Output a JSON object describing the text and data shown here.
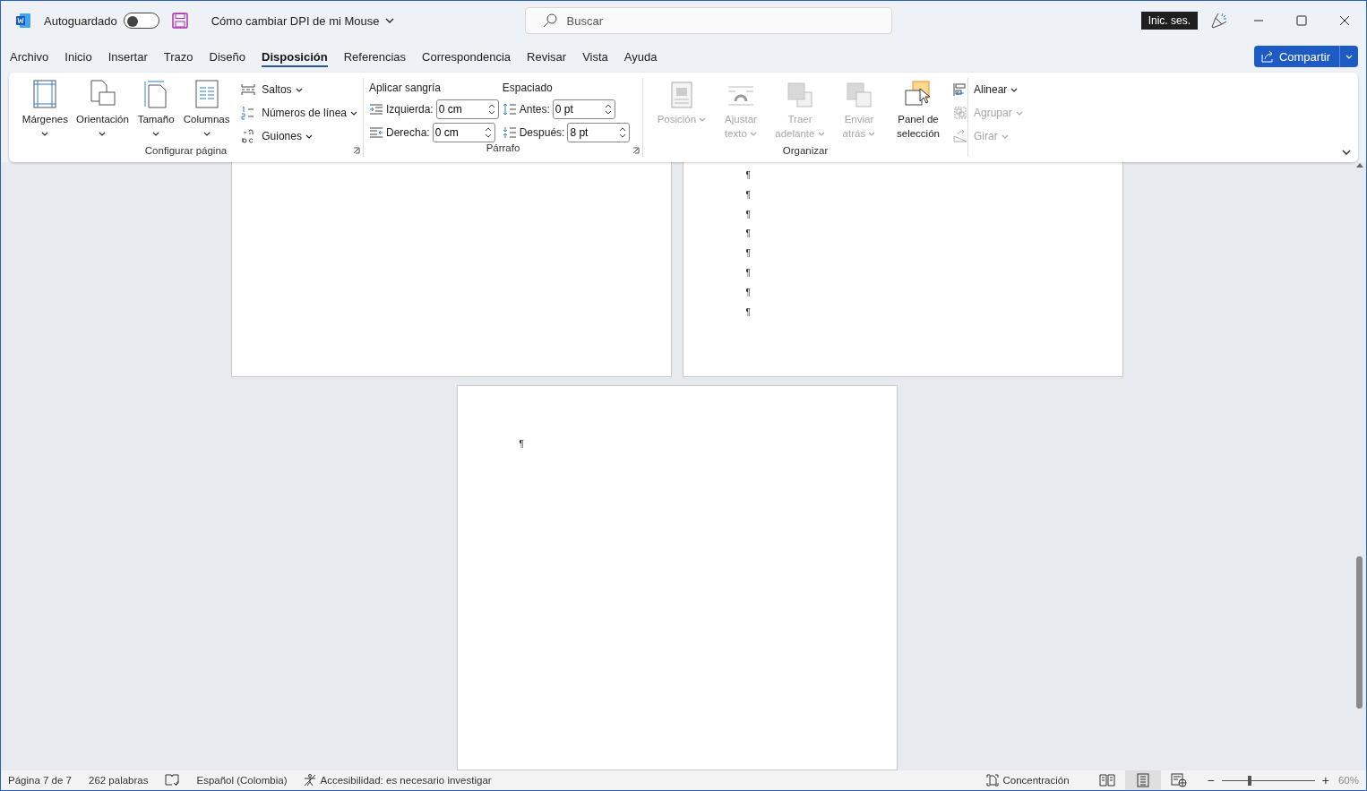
{
  "titlebar": {
    "autosave": {
      "label": "Autoguardado",
      "on": false
    },
    "document_title": "Cómo cambiar DPI de mi Mouse",
    "search": {
      "placeholder": "Buscar"
    },
    "sign_in": "Inic. ses."
  },
  "tabs": [
    {
      "label": "Archivo",
      "selected": false
    },
    {
      "label": "Inicio",
      "selected": false
    },
    {
      "label": "Insertar",
      "selected": false
    },
    {
      "label": "Trazo",
      "selected": false
    },
    {
      "label": "Diseño",
      "selected": false
    },
    {
      "label": "Disposición",
      "selected": true
    },
    {
      "label": "Referencias",
      "selected": false
    },
    {
      "label": "Correspondencia",
      "selected": false
    },
    {
      "label": "Revisar",
      "selected": false
    },
    {
      "label": "Vista",
      "selected": false
    },
    {
      "label": "Ayuda",
      "selected": false
    }
  ],
  "share_button": "Compartir",
  "ribbon": {
    "page_setup": {
      "title": "Configurar página",
      "large_buttons": [
        {
          "label": "Márgenes",
          "kind": "margins",
          "dropdown": true,
          "disabled": false
        },
        {
          "label": "Orientación",
          "kind": "orientation",
          "dropdown": true,
          "disabled": false
        },
        {
          "label": "Tamaño",
          "kind": "size",
          "dropdown": true,
          "disabled": false
        },
        {
          "label": "Columnas",
          "kind": "columns",
          "dropdown": true,
          "disabled": false
        }
      ],
      "small_buttons": [
        {
          "label": "Saltos",
          "kind": "breaks",
          "disabled": false
        },
        {
          "label": "Números de línea",
          "kind": "line_numbers",
          "disabled": false
        },
        {
          "label": "Guiones",
          "kind": "hyphenation",
          "disabled": false
        }
      ]
    },
    "paragraph": {
      "title": "Párrafo",
      "indent_heading": "Aplicar sangría",
      "spacing_heading": "Espaciado",
      "indent": [
        {
          "label": "Izquierda:",
          "value": "0 cm",
          "kind": "indent_left"
        },
        {
          "label": "Derecha:",
          "value": "0 cm",
          "kind": "indent_right"
        }
      ],
      "spacing": [
        {
          "label": "Antes:",
          "value": "0 pt",
          "kind": "before"
        },
        {
          "label": "Después:",
          "value": "8 pt",
          "kind": "after"
        }
      ]
    },
    "arrange": {
      "title": "Organizar",
      "large_buttons": [
        {
          "label": "Posición",
          "kind": "position",
          "dropdown": true,
          "disabled": true
        },
        {
          "label": "Ajustar texto",
          "kind": "wrap",
          "dropdown": true,
          "disabled": true
        },
        {
          "label": "Traer adelante",
          "kind": "forward",
          "dropdown": true,
          "disabled": true
        },
        {
          "label": "Enviar atrás",
          "kind": "backward",
          "dropdown": true,
          "disabled": true
        },
        {
          "label": "Panel de selección",
          "kind": "selection",
          "dropdown": false,
          "disabled": false
        }
      ],
      "small_buttons": [
        {
          "label": "Alinear",
          "kind": "align",
          "disabled": false
        },
        {
          "label": "Agrupar",
          "kind": "group",
          "disabled": true
        },
        {
          "label": "Girar",
          "kind": "rotate",
          "disabled": true
        }
      ]
    }
  },
  "document": {
    "top_pages": [
      {
        "kind": "blank"
      },
      {
        "kind": "text",
        "marks": [
          "¶",
          "¶",
          "¶",
          "¶",
          "¶",
          "¶",
          "¶",
          "¶"
        ]
      }
    ],
    "bottom_page": {
      "marks": [
        "¶"
      ]
    }
  },
  "status_bar": {
    "page": "Página 7 de 7",
    "words": "262 palabras",
    "language": "Español (Colombia)",
    "accessibility": "Accesibilidad: es necesario investigar",
    "focus": "Concentración",
    "views": [
      {
        "kind": "read",
        "selected": false
      },
      {
        "kind": "print",
        "selected": true
      },
      {
        "kind": "web",
        "selected": false
      }
    ],
    "zoom_out": "−",
    "zoom_in": "+",
    "zoom": {
      "level": 0.28
    },
    "zoom_value": "60%"
  }
}
